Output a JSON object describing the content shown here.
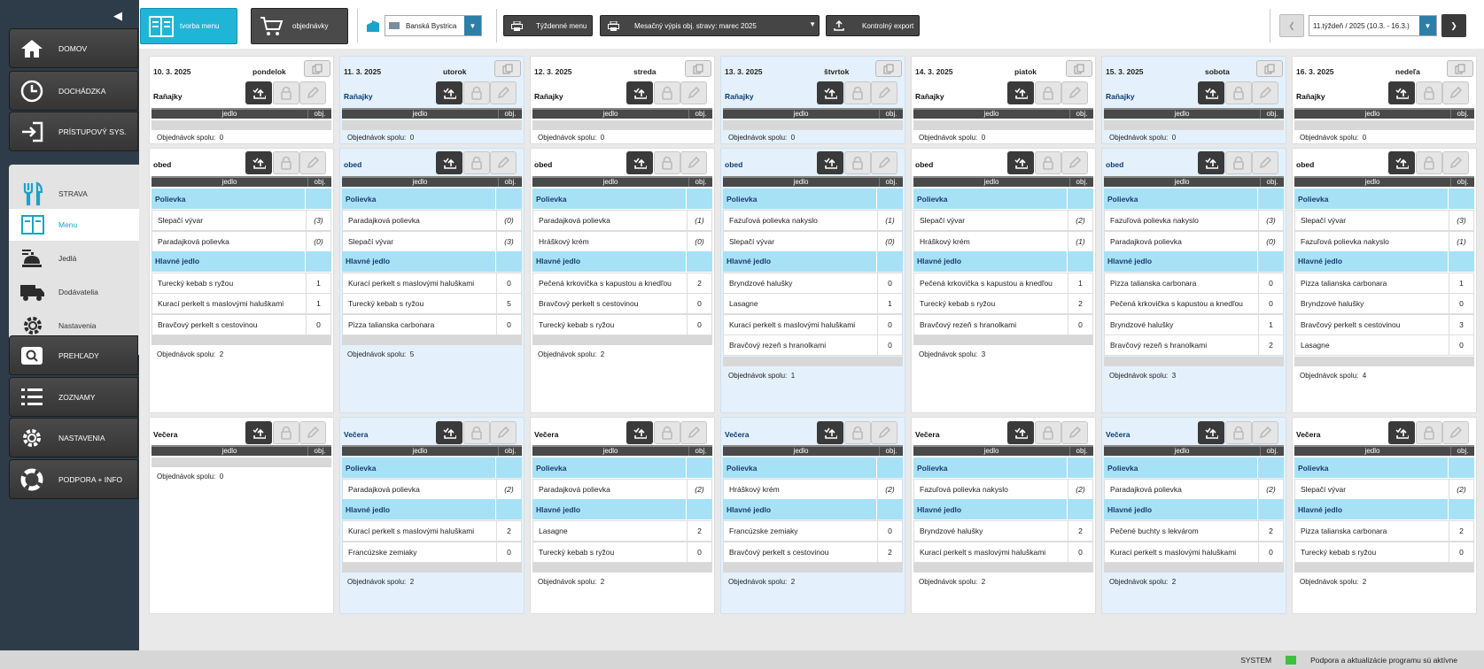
{
  "sidebar": {
    "nav": [
      {
        "label": "DOMOV",
        "icon": "home-icon"
      },
      {
        "label": "DOCHÁDZKA",
        "icon": "clock-icon"
      },
      {
        "label": "PRÍSTUPOVÝ SYS.",
        "icon": "login-icon"
      },
      {
        "label": "STRAVA",
        "icon": "cutlery-icon"
      },
      {
        "label": "PREHĽADY",
        "icon": "search-icon"
      },
      {
        "label": "ZOZNAMY",
        "icon": "list-icon"
      },
      {
        "label": "NASTAVENIA",
        "icon": "gear-icon"
      },
      {
        "label": "PODPORA + INFO",
        "icon": "lifebuoy-icon"
      }
    ],
    "sub": [
      {
        "label": "Menu",
        "icon": "menu-icon",
        "active": true
      },
      {
        "label": "Jedlá",
        "icon": "chef-icon"
      },
      {
        "label": "Dodávatelia",
        "icon": "truck-icon"
      },
      {
        "label": "Nastavenia",
        "icon": "gear-icon"
      }
    ]
  },
  "toolbar": {
    "tvorba_menu": "tvorba menu",
    "objednavky": "objednávky",
    "location": "Banská Bystrica",
    "tyzdenne_menu": "Týždenné menu",
    "mesacny_vypis": "Mesačný výpis obj. stravy: marec 2025",
    "kontrolny_export": "Kontrolný export",
    "week": "11.týždeň / 2025 (10.3. - 16.3.)"
  },
  "table": {
    "col_food": "jedlo",
    "col_orders": "obj."
  },
  "labels": {
    "ranajky": "Raňajky",
    "obed": "obed",
    "vecera": "Večera",
    "polievka": "Polievka",
    "hlavne": "Hlavné jedlo",
    "total": "Objednávok spolu:"
  },
  "days": [
    {
      "date": "10. 3. 2025",
      "name": "pondelok",
      "hl": false,
      "ranajky_total": "0",
      "obed": {
        "soups": [
          [
            "Slepačí vývar",
            "(3)"
          ],
          [
            "Paradajková polievka",
            "(0)"
          ]
        ],
        "mains": [
          [
            "Turecký kebab s ryžou",
            "1"
          ],
          [
            "Kurací perkelt s maslovými haluškami",
            "1"
          ],
          [
            "Bravčový perkelt s cestovinou",
            "0"
          ]
        ],
        "total": "2"
      },
      "vecera": {
        "soups": [],
        "mains": [],
        "total": "0"
      }
    },
    {
      "date": "11. 3. 2025",
      "name": "utorok",
      "hl": true,
      "ranajky_total": "0",
      "obed": {
        "soups": [
          [
            "Paradajková polievka",
            "(0)"
          ],
          [
            "Slepačí vývar",
            "(3)"
          ]
        ],
        "mains": [
          [
            "Kurací perkelt s maslovými haluškami",
            "0"
          ],
          [
            "Turecký kebab s ryžou",
            "5"
          ],
          [
            "Pizza talianska carbonara",
            "0"
          ]
        ],
        "total": "5"
      },
      "vecera": {
        "soups": [
          [
            "Paradajková polievka",
            "(2)"
          ]
        ],
        "mains": [
          [
            "Kurací perkelt s maslovými haluškami",
            "2"
          ],
          [
            "Francúzske zemiaky",
            "0"
          ]
        ],
        "total": "2"
      }
    },
    {
      "date": "12. 3. 2025",
      "name": "streda",
      "hl": false,
      "ranajky_total": "0",
      "obed": {
        "soups": [
          [
            "Paradajková polievka",
            "(1)"
          ],
          [
            "Hráškový krém",
            "(0)"
          ]
        ],
        "mains": [
          [
            "Pečená krkovička s kapustou a knedľou",
            "2"
          ],
          [
            "Bravčový perkelt s cestovinou",
            "0"
          ],
          [
            "Turecký kebab s ryžou",
            "0"
          ]
        ],
        "total": "2"
      },
      "vecera": {
        "soups": [
          [
            "Paradajková polievka",
            "(2)"
          ]
        ],
        "mains": [
          [
            "Lasagne",
            "2"
          ],
          [
            "Turecký kebab s ryžou",
            "0"
          ]
        ],
        "total": "2"
      }
    },
    {
      "date": "13. 3. 2025",
      "name": "štvrtok",
      "hl": true,
      "ranajky_total": "0",
      "obed": {
        "soups": [
          [
            "Fazuľová polievka nakyslo",
            "(1)"
          ],
          [
            "Slepačí vývar",
            "(0)"
          ]
        ],
        "mains": [
          [
            "Bryndzové halušky",
            "0"
          ],
          [
            "Lasagne",
            "1"
          ],
          [
            "Kurací perkelt s maslovými haluškami",
            "0"
          ],
          [
            "Bravčový rezeň s hranolkami",
            "0"
          ]
        ],
        "total": "1"
      },
      "vecera": {
        "soups": [
          [
            "Hráškový krém",
            "(2)"
          ]
        ],
        "mains": [
          [
            "Francúzske zemiaky",
            "0"
          ],
          [
            "Bravčový perkelt s cestovinou",
            "2"
          ]
        ],
        "total": "2"
      }
    },
    {
      "date": "14. 3. 2025",
      "name": "piatok",
      "hl": false,
      "ranajky_total": "0",
      "obed": {
        "soups": [
          [
            "Slepačí vývar",
            "(2)"
          ],
          [
            "Hráškový krém",
            "(1)"
          ]
        ],
        "mains": [
          [
            "Pečená krkovička s kapustou a knedľou",
            "1"
          ],
          [
            "Turecký kebab s ryžou",
            "2"
          ],
          [
            "Bravčový rezeň s hranolkami",
            "0"
          ]
        ],
        "total": "3"
      },
      "vecera": {
        "soups": [
          [
            "Fazuľová polievka nakyslo",
            "(2)"
          ]
        ],
        "mains": [
          [
            "Bryndzové halušky",
            "2"
          ],
          [
            "Kurací perkelt s maslovými haluškami",
            "0"
          ]
        ],
        "total": "2"
      }
    },
    {
      "date": "15. 3. 2025",
      "name": "sobota",
      "hl": true,
      "ranajky_total": "0",
      "obed": {
        "soups": [
          [
            "Fazuľová polievka nakyslo",
            "(3)"
          ],
          [
            "Paradajková polievka",
            "(0)"
          ]
        ],
        "mains": [
          [
            "Pizza talianska carbonara",
            "0"
          ],
          [
            "Pečená krkovička s kapustou a knedľou",
            "0"
          ],
          [
            "Bryndzové halušky",
            "1"
          ],
          [
            "Bravčový rezeň s hranolkami",
            "2"
          ]
        ],
        "total": "3"
      },
      "vecera": {
        "soups": [
          [
            "Paradajková polievka",
            "(2)"
          ]
        ],
        "mains": [
          [
            "Pečené buchty s lekvárom",
            "2"
          ],
          [
            "Kurací perkelt s maslovými haluškami",
            "0"
          ]
        ],
        "total": "2"
      }
    },
    {
      "date": "16. 3. 2025",
      "name": "nedeľa",
      "hl": false,
      "ranajky_total": "0",
      "obed": {
        "soups": [
          [
            "Slepačí vývar",
            "(3)"
          ],
          [
            "Fazuľová polievka nakyslo",
            "(1)"
          ]
        ],
        "mains": [
          [
            "Pizza talianska carbonara",
            "1"
          ],
          [
            "Bryndzové halušky",
            "0"
          ],
          [
            "Bravčový perkelt s cestovinou",
            "3"
          ],
          [
            "Lasagne",
            "0"
          ]
        ],
        "total": "4"
      },
      "vecera": {
        "soups": [
          [
            "Slepačí vývar",
            "(2)"
          ]
        ],
        "mains": [
          [
            "Pizza talianska carbonara",
            "2"
          ],
          [
            "Turecký kebab s ryžou",
            "0"
          ]
        ],
        "total": "2"
      }
    }
  ],
  "status": {
    "system": "SYSTEM",
    "support": "Podpora a aktualizácie programu sú aktívne"
  },
  "colors": {
    "accent": "#1fb5d6",
    "category": "#a7e1f6",
    "highlight_day": "#e4f1fc",
    "sidebar": "#2d3c48"
  }
}
